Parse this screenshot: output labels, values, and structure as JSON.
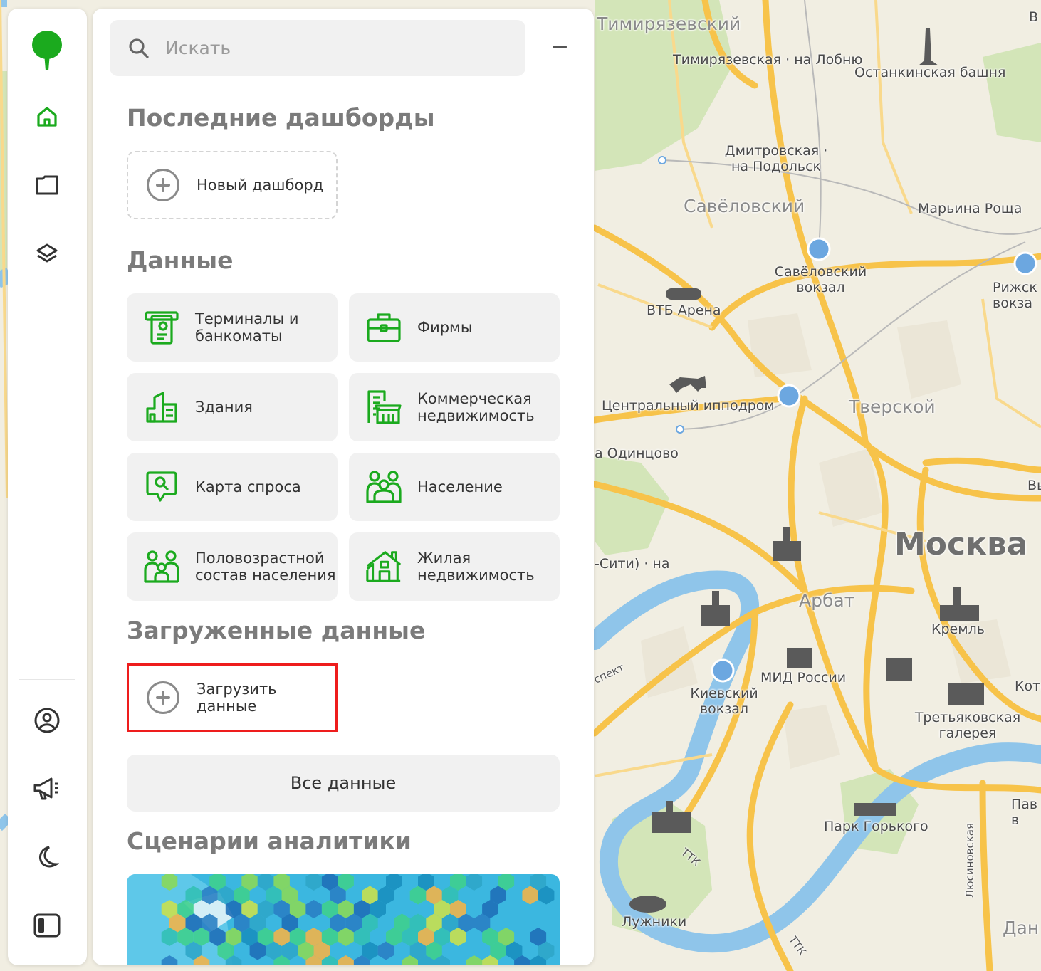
{
  "map": {
    "districts": [
      "Тимирязевский",
      "Савёловский",
      "Тверской",
      "Арбат"
    ],
    "city": "Москва",
    "stations": [
      "Тимирязевская · на Лобню",
      "Дмитровская · на Подольск",
      "Марьина Роща",
      "Савёловский вокзал",
      "Рижск вокза",
      "ВТБ Арена",
      "Центральный ипподром",
      "а Одинцово",
      "-Сити) · на",
      "Киевский вокзал",
      "МИД России",
      "Кремль",
      "Третьяковская галерея",
      "Парк Горького",
      "Лужники",
      "Останкинская башня"
    ],
    "edge_labels": [
      "Пав в",
      "Дан",
      "Кото",
      "Вы",
      "В"
    ],
    "roads": [
      "ТТК",
      "ТТК",
      "Люсиновская",
      "спект"
    ]
  },
  "rail": {
    "items": [
      {
        "name": "logo",
        "icon": "tree-logo-icon"
      },
      {
        "name": "home",
        "icon": "home-icon"
      },
      {
        "name": "folder",
        "icon": "folder-icon"
      },
      {
        "name": "layers",
        "icon": "layers-icon"
      },
      {
        "name": "profile",
        "icon": "user-circle-icon"
      },
      {
        "name": "news",
        "icon": "megaphone-icon"
      },
      {
        "name": "theme",
        "icon": "moon-icon"
      },
      {
        "name": "panel",
        "icon": "sidebar-toggle-icon"
      }
    ],
    "accent": "#1baa1e"
  },
  "panel": {
    "search": {
      "placeholder": "Искать"
    },
    "recent_title": "Последние дашборды",
    "new_dashboard_label": "Новый дашборд",
    "data_title": "Данные",
    "data_cards": [
      {
        "label": "Терминалы и банкоматы",
        "icon": "atm-icon"
      },
      {
        "label": "Фирмы",
        "icon": "briefcase-icon"
      },
      {
        "label": "Здания",
        "icon": "building-icon"
      },
      {
        "label": "Коммерческая недвижимость",
        "icon": "commercial-building-icon"
      },
      {
        "label": "Карта спроса",
        "icon": "search-bubble-icon"
      },
      {
        "label": "Население",
        "icon": "people-icon"
      },
      {
        "label": "Половозрастной состав населения",
        "icon": "family-icon"
      },
      {
        "label": "Жилая недвижимость",
        "icon": "house-icon"
      }
    ],
    "uploaded_title": "Загруженные данные",
    "upload_label": "Загрузить данные",
    "all_data_label": "Все данные",
    "scenarios_title": "Сценарии аналитики",
    "highlight_color": "#ee1d1d"
  }
}
